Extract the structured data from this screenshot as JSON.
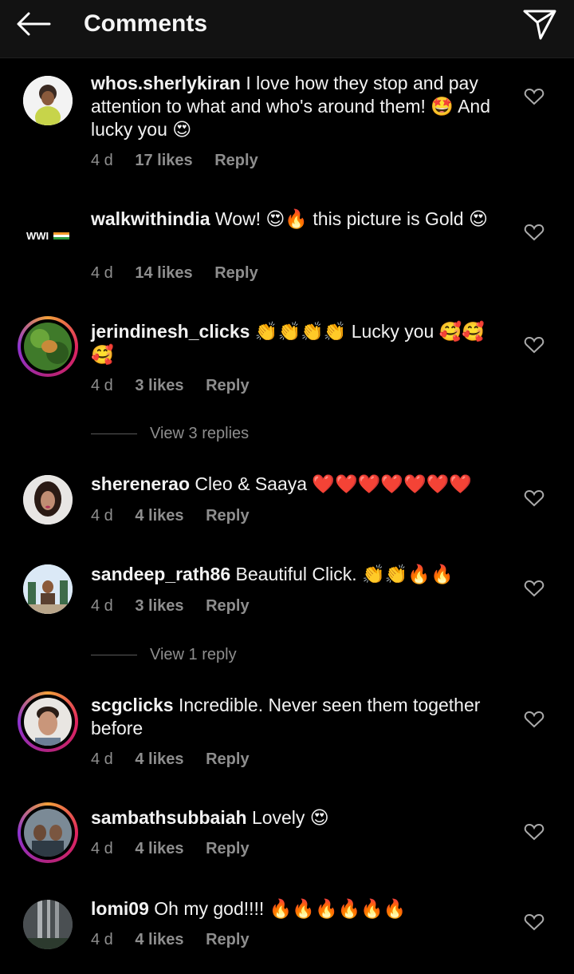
{
  "header": {
    "title": "Comments"
  },
  "comments": [
    {
      "username": "whos.sherlykiran",
      "text": "I love how they stop and pay attention to what and who's around them! 🤩 And lucky you 😍",
      "time": "4 d",
      "likes": "17 likes",
      "reply": "Reply"
    },
    {
      "username": "walkwithindia",
      "avatar_text": "WWI",
      "text": "Wow! 😍🔥 this picture is Gold 😍",
      "time": "4 d",
      "likes": "14 likes",
      "reply": "Reply"
    },
    {
      "username": "jerindinesh_clicks",
      "text": "👏👏👏👏 Lucky you 🥰🥰 🥰",
      "time": "4 d",
      "likes": "3 likes",
      "reply": "Reply",
      "view_replies": "View 3 replies"
    },
    {
      "username": "sherenerao",
      "text": "Cleo & Saaya ❤️❤️❤️❤️❤️❤️❤️",
      "time": "4 d",
      "likes": "4 likes",
      "reply": "Reply"
    },
    {
      "username": "sandeep_rath86",
      "text": "Beautiful Click. 👏👏🔥🔥",
      "time": "4 d",
      "likes": "3 likes",
      "reply": "Reply",
      "view_replies": "View 1 reply"
    },
    {
      "username": "scgclicks",
      "text": "Incredible. Never seen them together before",
      "time": "4 d",
      "likes": "4 likes",
      "reply": "Reply"
    },
    {
      "username": "sambathsubbaiah",
      "text": "Lovely 😍",
      "time": "4 d",
      "likes": "4 likes",
      "reply": "Reply"
    },
    {
      "username": "lomi09",
      "text": "Oh my god!!!! 🔥🔥🔥🔥🔥🔥",
      "time": "4 d",
      "likes": "4 likes",
      "reply": "Reply"
    }
  ]
}
